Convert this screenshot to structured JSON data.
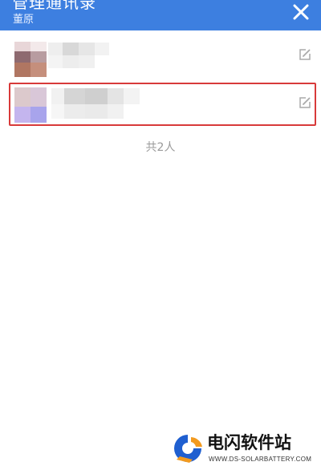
{
  "header": {
    "title": "管理通讯录",
    "subtitle": "董原",
    "close_icon": "close-icon",
    "background": "#3d7fe0"
  },
  "contacts": [
    {
      "avatar": "blurred-avatar",
      "name": "",
      "edit_icon": "edit-icon"
    },
    {
      "avatar": "blurred-avatar",
      "name": "",
      "edit_icon": "edit-icon",
      "highlighted": true
    }
  ],
  "summary": {
    "total": "共2人"
  },
  "highlight_color": "#d83a3a",
  "watermark": {
    "title": "电闪软件站",
    "url": "WWW.DS-SOLARBATTERY.COM",
    "colors": {
      "blue": "#1f5fd0",
      "orange": "#f29a1f"
    }
  }
}
